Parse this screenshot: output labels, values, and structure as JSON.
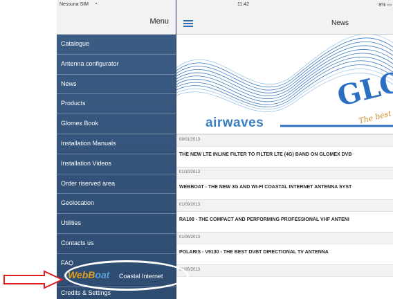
{
  "status": {
    "carrier": "Nessuna SIM",
    "time": "11:42",
    "battery": "8%"
  },
  "sidebar": {
    "title": "Menu",
    "items": [
      {
        "label": "Catalogue"
      },
      {
        "label": "Antenna configurator"
      },
      {
        "label": "News"
      },
      {
        "label": "Products"
      },
      {
        "label": "Glomex Book"
      },
      {
        "label": "Installation Manuals"
      },
      {
        "label": "Installation Videos"
      },
      {
        "label": "Order riserved area"
      },
      {
        "label": "Geolocation"
      },
      {
        "label": "Utilities"
      },
      {
        "label": "Contacts us"
      },
      {
        "label": "FAQ"
      }
    ],
    "coastal": {
      "logo": "WebBoat",
      "label": "Coastal Internet"
    },
    "credits": "Credits & Settings"
  },
  "main": {
    "title": "News",
    "banner": {
      "product": "airwaves",
      "brand": "GLO",
      "slogan": "The best"
    },
    "news": [
      {
        "date": "09/01/2013",
        "headline": "THE NEW LTE INLINE FILTER TO FILTER LTE (4G) BAND ON GLOMEX DVB"
      },
      {
        "date": "01/10/2013",
        "headline": "WEBBOAT - THE NEW 3G AND WI-FI COASTAL INTERNET ANTENNA SYST"
      },
      {
        "date": "01/09/2013",
        "headline": "RA108 - THE COMPACT AND PERFORMING PROFESSIONAL VHF ANTENI"
      },
      {
        "date": "01/06/2013",
        "headline": "POLARIS - V9130 - THE BEST DVBT DIRECTIONAL TV ANTENNA"
      },
      {
        "date": "01/05/2013",
        "headline": ""
      }
    ]
  },
  "colors": {
    "sidebar_bg": "#3d5e86",
    "accent": "#2f6db8",
    "highlight": "#ffffff",
    "annotation_arrow": "#e02020"
  }
}
